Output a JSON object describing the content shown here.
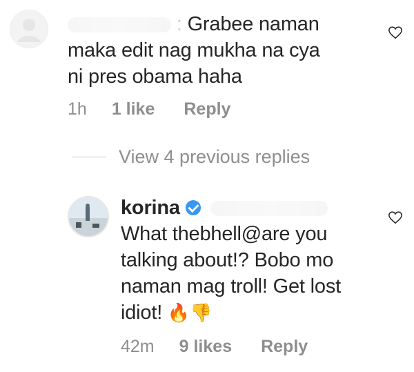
{
  "comment1": {
    "text_first": "Grabee naman",
    "text_second": "maka edit nag mukha na cya",
    "text_third": "ni pres obama haha",
    "time": "1h",
    "likes": "1 like",
    "reply_label": "Reply"
  },
  "view_replies_label": "View 4 previous replies",
  "comment2": {
    "username": "korina",
    "line1": "What thebhell@are you",
    "line2": "talking about!? Bobo mo",
    "line3": "naman mag troll! Get lost",
    "line4": "idiot!",
    "emoji_fire": "🔥",
    "emoji_thumb": "👎",
    "time": "42m",
    "likes": "9 likes",
    "reply_label": "Reply"
  },
  "icons": {
    "heart": "heart-outline-icon",
    "verified": "verified-badge-icon"
  }
}
